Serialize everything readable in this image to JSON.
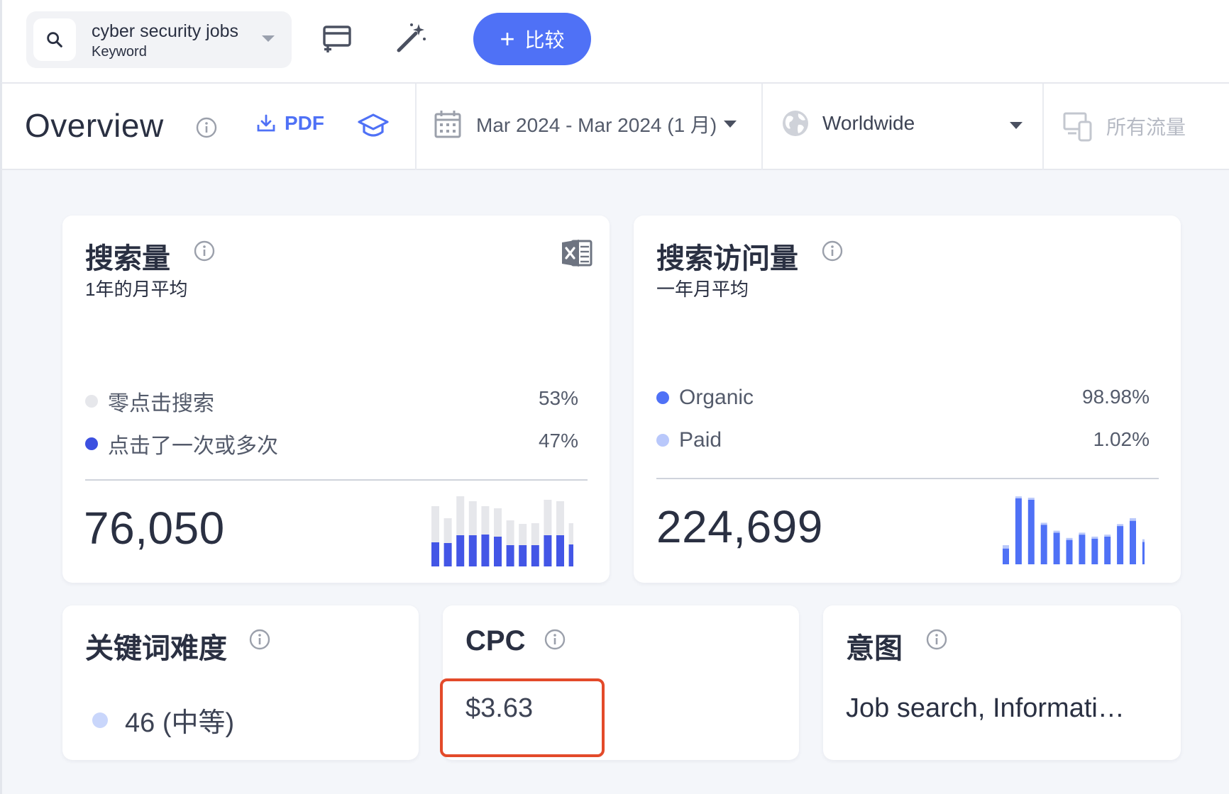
{
  "search": {
    "keyword": "cyber security jobs",
    "type_label": "Keyword",
    "compare_label": "比较",
    "compare_plus": "+"
  },
  "toolbar": {
    "title": "Overview",
    "pdf_label": "PDF",
    "date_range": "Mar 2024 - Mar 2024 (1 月)",
    "geo": "Worldwide",
    "traffic": "所有流量"
  },
  "search_volume": {
    "title": "搜索量",
    "subtitle": "1年的月平均",
    "legend": [
      {
        "label": "零点击搜索",
        "pct": "53%",
        "color": "#e6e7eb"
      },
      {
        "label": "点击了一次或多次",
        "pct": "47%",
        "color": "#3c50e0"
      }
    ],
    "total": "76,050",
    "chart_data": {
      "type": "bar",
      "stacked": true,
      "series": [
        {
          "color": "#4356e6",
          "values": [
            0.34,
            0.33,
            0.44,
            0.44,
            0.45,
            0.42,
            0.3,
            0.3,
            0.3,
            0.44,
            0.44,
            0.31
          ]
        },
        {
          "color": "#e6e7eb",
          "values": [
            0.51,
            0.35,
            0.55,
            0.48,
            0.4,
            0.4,
            0.35,
            0.3,
            0.31,
            0.5,
            0.48,
            0.3
          ]
        }
      ]
    }
  },
  "search_visits": {
    "title": "搜索访问量",
    "subtitle": "一年月平均",
    "legend": [
      {
        "label": "Organic",
        "pct": "98.98%",
        "color": "#4f71f6"
      },
      {
        "label": "Paid",
        "pct": "1.02%",
        "color": "#b9c8fb"
      }
    ],
    "total": "224,699",
    "chart_data": {
      "type": "bar",
      "stacked": true,
      "series": [
        {
          "color": "#4f71f6",
          "values": [
            0.24,
            1.0,
            0.98,
            0.6,
            0.48,
            0.37,
            0.45,
            0.39,
            0.42,
            0.58,
            0.66,
            0.34
          ]
        },
        {
          "color": "#b9c8fb",
          "values": [
            0.05,
            0.03,
            0.03,
            0.03,
            0.03,
            0.03,
            0.03,
            0.03,
            0.03,
            0.03,
            0.04,
            0.04
          ]
        }
      ]
    }
  },
  "keyword_difficulty": {
    "title": "关键词难度",
    "value": "46 (中等)",
    "dot_color": "#c9d6fb"
  },
  "cpc": {
    "title": "CPC",
    "value": "$3.63"
  },
  "intent": {
    "title": "意图",
    "value": "Job search, Informati…"
  },
  "colors": {
    "accent": "#4f71f6",
    "highlight": "#e34a2a"
  }
}
